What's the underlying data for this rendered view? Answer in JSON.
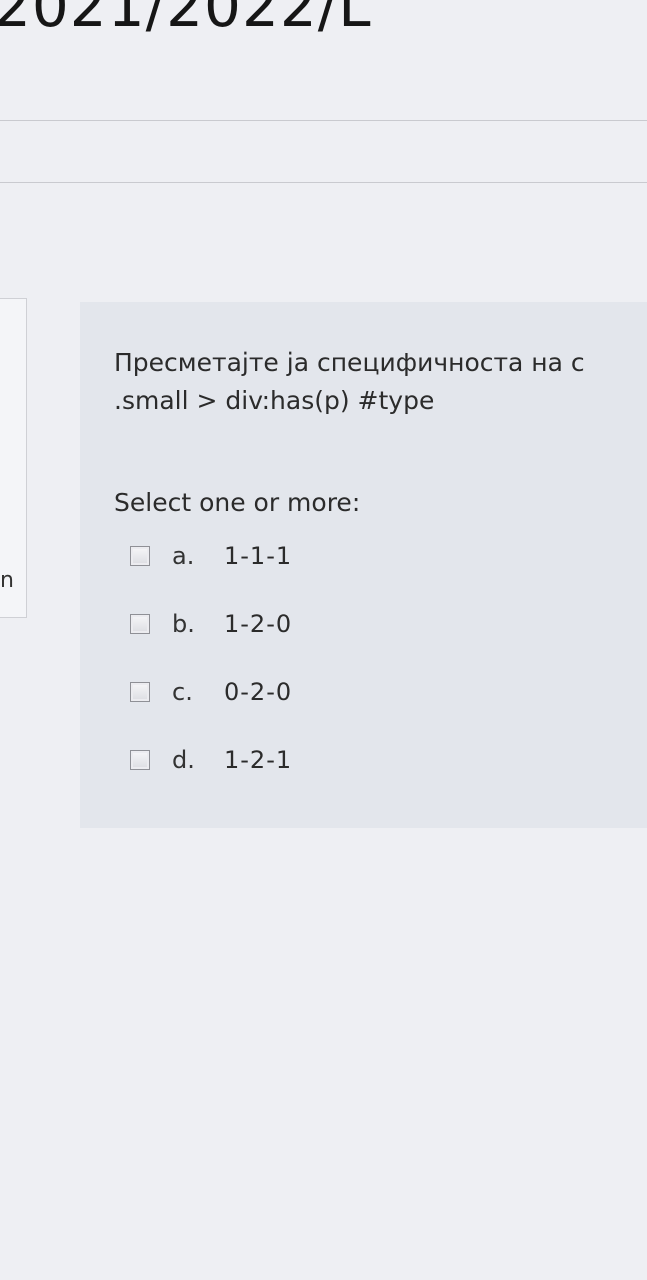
{
  "header": {
    "title": "2021/2022/L"
  },
  "question": {
    "text_line1": "Пресметајте ја специфичноста на с",
    "text_line2": ".small > div:has(p) #type",
    "prompt": "Select one or more:",
    "options": [
      {
        "letter": "a.",
        "value": "1-1-1",
        "checked": false
      },
      {
        "letter": "b.",
        "value": "1-2-0",
        "checked": false
      },
      {
        "letter": "c.",
        "value": "0-2-0",
        "checked": false
      },
      {
        "letter": "d.",
        "value": "1-2-1",
        "checked": false
      }
    ]
  },
  "sidebar": {
    "stub_text": "n"
  }
}
